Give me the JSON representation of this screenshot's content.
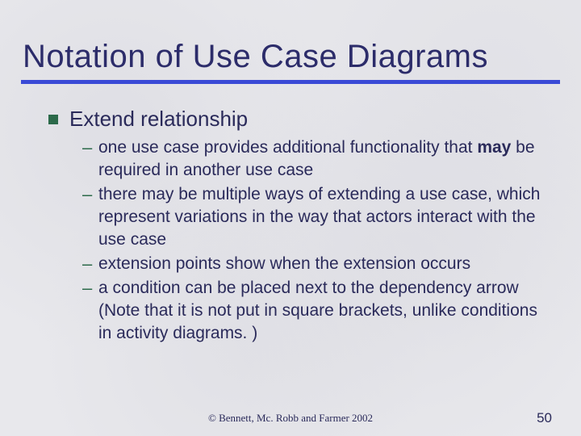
{
  "title": "Notation of Use Case Diagrams",
  "main_bullet": "Extend relationship",
  "sub_bullets": [
    {
      "pre": "one use case provides additional functionality that ",
      "bold": "may",
      "post": " be required in another use case"
    },
    {
      "pre": "there may be multiple ways of extending a use case, which represent variations in the way that actors interact with the use case",
      "bold": "",
      "post": ""
    },
    {
      "pre": "extension points show when the extension occurs",
      "bold": "",
      "post": ""
    },
    {
      "pre": "a condition can be placed next to the dependency arrow (Note that it is not put in square brackets, unlike conditions in activity diagrams. )",
      "bold": "",
      "post": ""
    }
  ],
  "footer": "©  Bennett, Mc. Robb and Farmer 2002",
  "page_number": "50"
}
